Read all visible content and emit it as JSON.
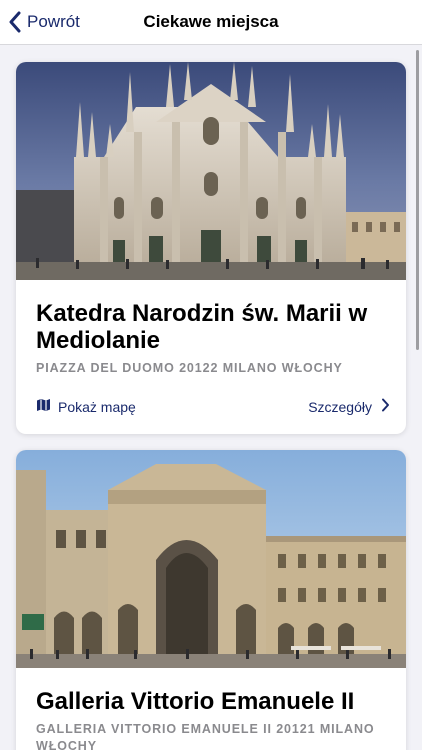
{
  "navbar": {
    "back_label": "Powrót",
    "title": "Ciekawe miejsca"
  },
  "places": [
    {
      "name": "Katedra Narodzin św. Marii w Mediolanie",
      "address": "PIAZZA DEL DUOMO 20122 MILANO WŁOCHY",
      "map_label": "Pokaż mapę",
      "details_label": "Szczegóły"
    },
    {
      "name": "Galleria Vittorio Emanuele II",
      "address": "GALLERIA VITTORIO EMANUELE II 20121 MILANO WŁOCHY"
    }
  ],
  "colors": {
    "accent": "#1a2a6c",
    "subtitle": "#8a8a8e",
    "background": "#f2f2f7"
  },
  "icons": {
    "back": "chevron-left-icon",
    "map": "map-icon",
    "details": "chevron-right-icon"
  }
}
